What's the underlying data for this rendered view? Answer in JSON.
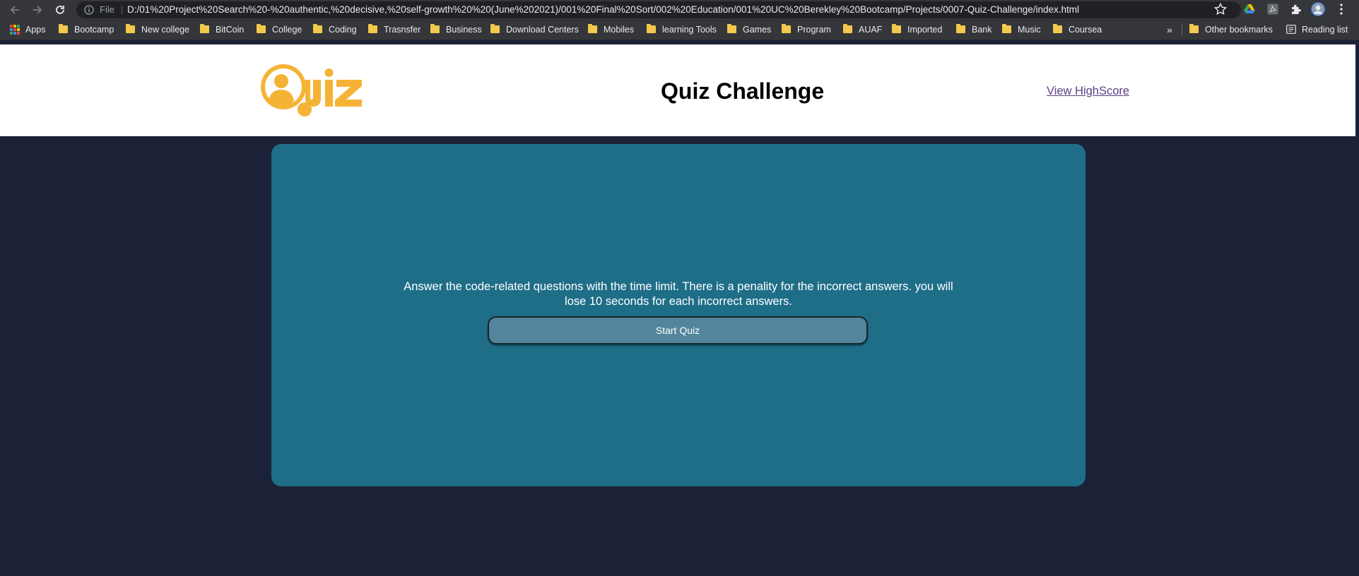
{
  "browser": {
    "omnibox": {
      "scheme_label": "File",
      "url": "D:/01%20Project%20Search%20-%20authentic,%20decisive,%20self-growth%20%20(June%202021)/001%20Final%20Sort/002%20Education/001%20UC%20Berekley%20Bootcamp/Projects/0007-Quiz-Challenge/index.html"
    },
    "bookmarks": [
      "Apps",
      "Bootcamp",
      "New college",
      "BitCoin",
      "College",
      "Coding",
      "Trasnsfer",
      "Business",
      "Download Centers",
      "Mobiles",
      "learning Tools",
      "Games",
      "Program",
      "AUAF",
      "Imported",
      "Bank",
      "Music",
      "Coursea"
    ],
    "overflow_label": "»",
    "other_bookmarks": "Other bookmarks",
    "reading_list": "Reading list"
  },
  "header": {
    "logo_text": "Quiz",
    "title": "Quiz Challenge",
    "highscore_link": "View HighScore"
  },
  "main": {
    "intro_text": "Answer the code-related questions with the time limit. There is a penality for the incorrect answers. you will lose 10 seconds for each incorrect answers.",
    "start_button": "Start Quiz"
  },
  "colors": {
    "page_background": "#1b2238",
    "card_background": "#1f6e88",
    "button_background": "#53859c",
    "logo_orange": "#f5b336",
    "link": "#5a3e86"
  },
  "icons": [
    "back-arrow-icon",
    "forward-arrow-icon",
    "reload-icon",
    "info-icon",
    "star-icon",
    "google-drive-icon",
    "pdf-extension-icon",
    "extensions-puzzle-icon",
    "profile-avatar-icon",
    "menu-kebab-icon",
    "apps-grid-icon",
    "folder-icon",
    "reading-list-icon"
  ]
}
